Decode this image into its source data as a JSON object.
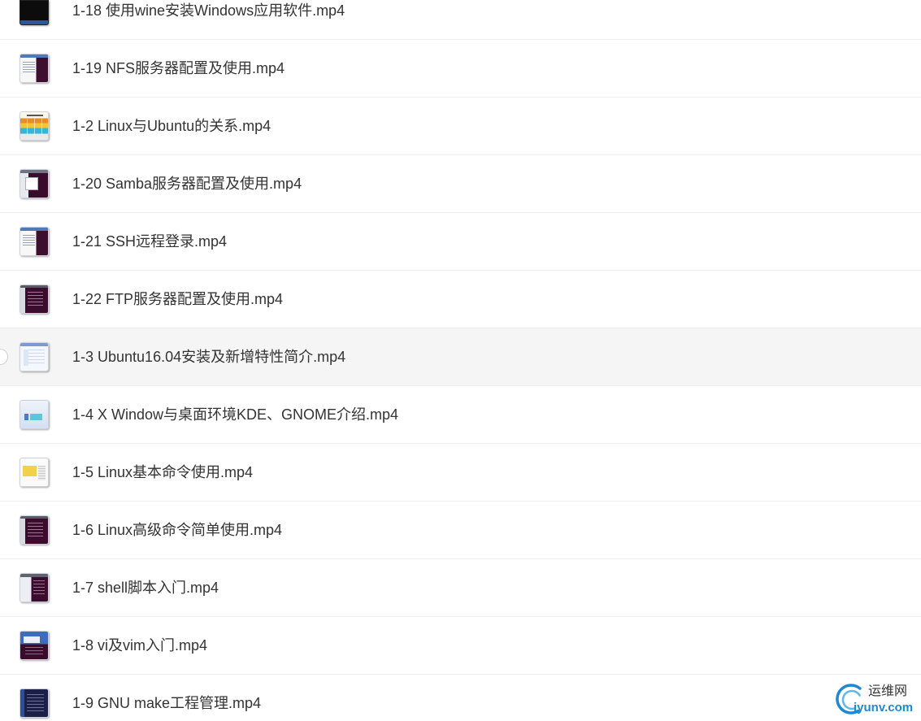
{
  "files": [
    {
      "name": "1-18 使用wine安装Windows应用软件.mp4",
      "thumbnail": "dark"
    },
    {
      "name": "1-19 NFS服务器配置及使用.mp4",
      "thumbnail": "window-terminal"
    },
    {
      "name": "1-2 Linux与Ubuntu的关系.mp4",
      "thumbnail": "slide-color"
    },
    {
      "name": "1-20 Samba服务器配置及使用.mp4",
      "thumbnail": "terminal-window"
    },
    {
      "name": "1-21 SSH远程登录.mp4",
      "thumbnail": "window-terminal"
    },
    {
      "name": "1-22 FTP服务器配置及使用.mp4",
      "thumbnail": "terminal"
    },
    {
      "name": "1-3 Ubuntu16.04安装及新增特性简介.mp4",
      "thumbnail": "window-light",
      "hovered": true
    },
    {
      "name": "1-4 X Window与桌面环境KDE、GNOME介绍.mp4",
      "thumbnail": "slide-blue"
    },
    {
      "name": "1-5 Linux基本命令使用.mp4",
      "thumbnail": "slide-yellow"
    },
    {
      "name": "1-6 Linux高级命令简单使用.mp4",
      "thumbnail": "terminal"
    },
    {
      "name": "1-7 shell脚本入门.mp4",
      "thumbnail": "terminal-panel"
    },
    {
      "name": "1-8 vi及vim入门.mp4",
      "thumbnail": "window-blue"
    },
    {
      "name": "1-9 GNU make工程管理.mp4",
      "thumbnail": "navy"
    }
  ],
  "watermark": {
    "brand_cn": "运维网",
    "domain": "iyunv.com",
    "logo_icon": "swirl-logo-icon"
  },
  "colors": {
    "text": "#333333",
    "separator": "#eeeeee",
    "hover_background": "#f5f5f5",
    "watermark_blue": "#1a8ad6"
  }
}
